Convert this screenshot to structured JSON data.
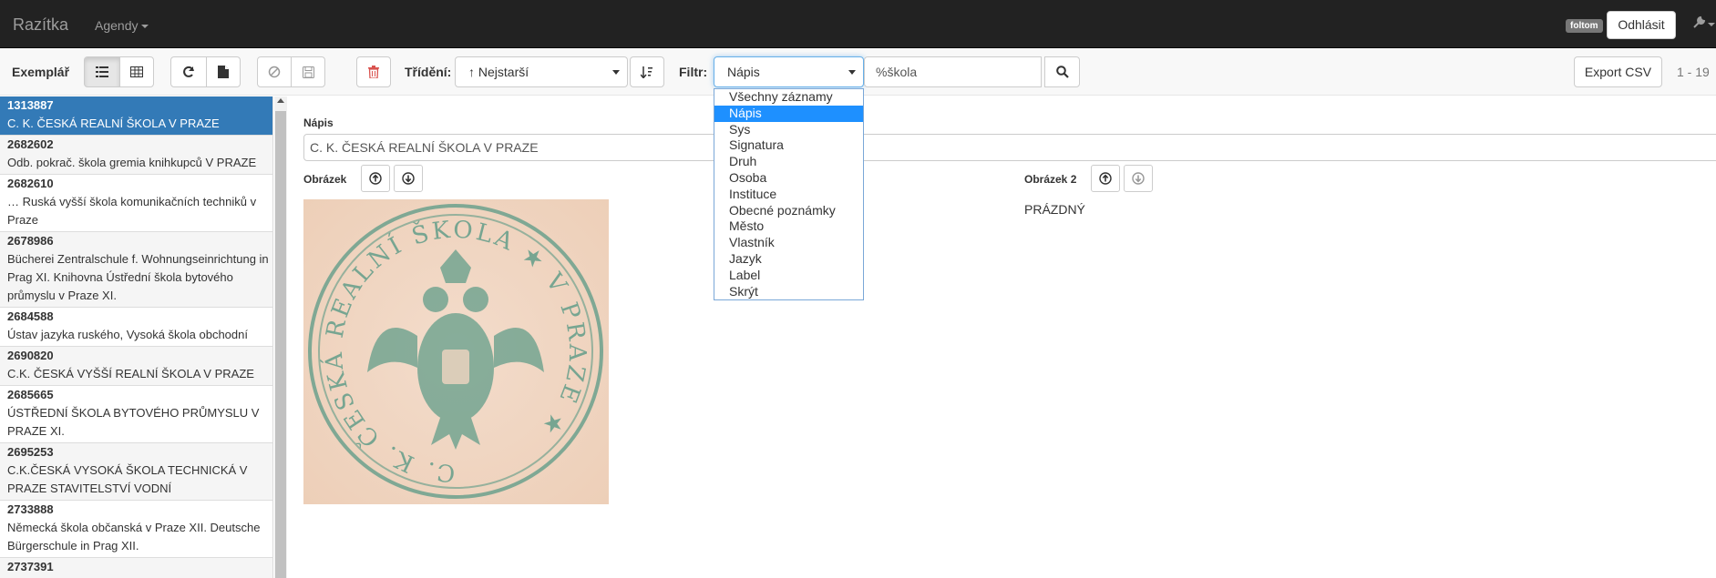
{
  "navbar": {
    "brand": "Razítka",
    "agendy": "Agendy",
    "user": "foltom",
    "logout": "Odhlásit"
  },
  "toolbar": {
    "exemplar_label": "Exemplář",
    "sort_label": "Třídění:",
    "sort_value": "↑ Nejstarší",
    "filter_label": "Filtr:",
    "filter_value": "Nápis",
    "search_value": "%škola",
    "export": "Export CSV",
    "pager": "1 - 19"
  },
  "list": [
    {
      "id": "1313887",
      "text": "C. K. ČESKÁ REALNÍ ŠKOLA V PRAZE"
    },
    {
      "id": "2682602",
      "text": "Odb. pokrač. škola gremia knihkupců V PRAZE"
    },
    {
      "id": "2682610",
      "text": "… Ruská vyšší škola komunikačních techniků v Praze"
    },
    {
      "id": "2678986",
      "text": "Bücherei Zentralschule f. Wohnungseinrichtung in Prag XI. Knihovna Ústřední škola bytového průmyslu v Praze XI."
    },
    {
      "id": "2684588",
      "text": "Ústav jazyka ruského, Vysoká škola obchodní"
    },
    {
      "id": "2690820",
      "text": "C.K. ČESKÁ VYŠŠÍ REALNÍ ŠKOLA V PRAZE"
    },
    {
      "id": "2685665",
      "text": "ÚSTŘEDNÍ ŠKOLA BYTOVÉHO PRŮMYSLU V PRAZE XI."
    },
    {
      "id": "2695253",
      "text": "C.K.ČESKÁ VYSOKÁ ŠKOLA TECHNICKÁ V PRAZE STAVITELSTVÍ VODNÍ"
    },
    {
      "id": "2733888",
      "text": "Německá škola občanská v Praze XII. Deutsche Bürgerschule in Prag XII."
    },
    {
      "id": "2737391",
      "text": ""
    }
  ],
  "detail": {
    "napis_label": "Nápis",
    "napis_value": "C. K. ČESKÁ REALNÍ ŠKOLA V PRAZE",
    "obrazek_label": "Obrázek",
    "obrazek2_label": "Obrázek 2",
    "empty": "PRÁZDNÝ",
    "stamp_text": "C.K. ČESKÁ REALNÍ ŠKOLA V PRAZE"
  },
  "dropdown": {
    "items": [
      "Všechny záznamy",
      "Nápis",
      "Sys",
      "Signatura",
      "Druh",
      "Osoba",
      "Instituce",
      "Obecné poznámky",
      "Město",
      "Vlastník",
      "Jazyk",
      "Label",
      "Skrýt"
    ],
    "selected": "Nápis"
  },
  "colors": {
    "navbar": "#222222",
    "selected": "#337ab7",
    "dropdown_selected": "#1e90ff",
    "stamp_ink": "#5a9a86",
    "paper": "#f2d8c5"
  }
}
